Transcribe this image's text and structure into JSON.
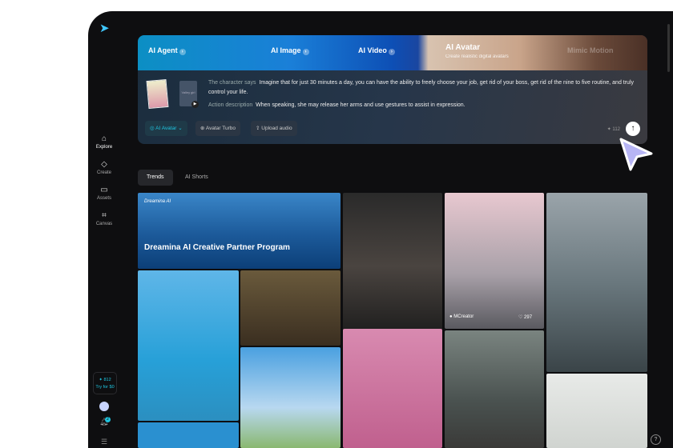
{
  "sidebar": {
    "items": [
      {
        "label": "Explore",
        "icon": "home-icon"
      },
      {
        "label": "Create",
        "icon": "diamond-icon"
      },
      {
        "label": "Assets",
        "icon": "folder-icon"
      },
      {
        "label": "Canvas",
        "icon": "crop-icon"
      }
    ],
    "credits": "✦ 812",
    "try": "Try for $0",
    "notifications": "2"
  },
  "banner": {
    "tabs": [
      "AI Agent",
      "AI Image",
      "AI Video",
      "AI Avatar",
      "Mimic Motion"
    ],
    "subtitle": "Create realistic digital avatars",
    "voice_label": "Valley girl",
    "char_label": "The character says",
    "char_text": "Imagine that for just 30 minutes a day, you can have the ability to freely choose your job, get rid of your boss, get rid of the nine to five routine, and truly control your life.",
    "action_label": "Action description",
    "action_text": "When speaking, she may release her arms and use gestures to assist in expression.",
    "buttons": {
      "mode": "AI Avatar",
      "turbo": "Avatar Turbo",
      "upload": "Upload audio"
    },
    "credits": "✦ 112"
  },
  "tabs": [
    "Trends",
    "AI Shorts"
  ],
  "feed": {
    "promo_brand": "Dreamina AI",
    "promo_title": "Dreamina AI Creative Partner Program",
    "creator": "MCreator",
    "likes": "297"
  },
  "colors": {
    "accent": "#1fc5e0",
    "cursor": "#b7b5f5"
  }
}
